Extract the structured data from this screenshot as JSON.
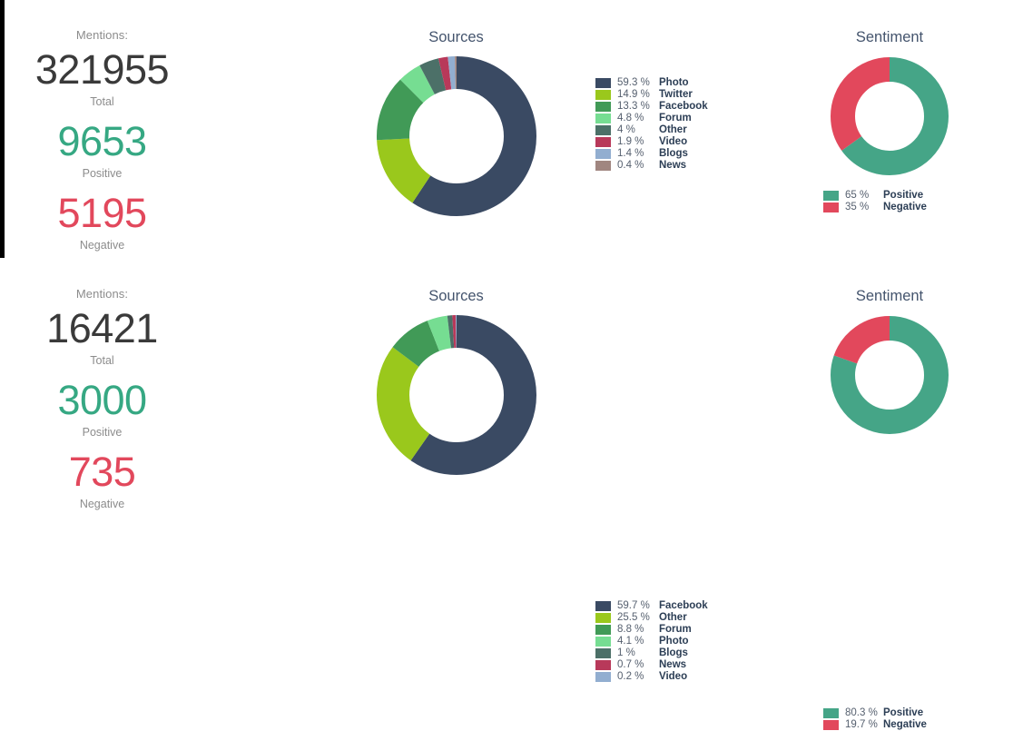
{
  "theme": {
    "navy": "#3a4a63",
    "lime": "#9ac81c",
    "green": "#419a57",
    "mint": "#76dd92",
    "slate_green": "#4c7068",
    "crimson": "#b8395a",
    "periwinkle": "#92aed0",
    "mauve": "#a08680",
    "sentiment_positive": "#45a587",
    "sentiment_negative": "#e2485c",
    "title_color": "#44546d",
    "total_color": "#3a3a3a"
  },
  "rows": [
    {
      "mentions": {
        "caption": "Mentions:",
        "total_value": "321955",
        "total_label": "Total",
        "positive_value": "9653",
        "positive_label": "Positive",
        "negative_value": "5195",
        "negative_label": "Negative"
      },
      "sources": {
        "title": "Sources",
        "chart_data": {
          "type": "pie",
          "title": "Sources",
          "donut": true,
          "start_angle": 0,
          "direction": "clockwise",
          "categories": [
            "Photo",
            "Twitter",
            "Facebook",
            "Forum",
            "Other",
            "Video",
            "Blogs",
            "News"
          ],
          "values": [
            59.3,
            14.9,
            13.3,
            4.8,
            4,
            1.9,
            1.4,
            0.4
          ],
          "unit": "%",
          "colors": [
            "#3a4a63",
            "#9ac81c",
            "#419a57",
            "#76dd92",
            "#4c7068",
            "#b8395a",
            "#92aed0",
            "#a08680"
          ],
          "legend_position": "right"
        },
        "legend": [
          {
            "pct": "59.3 %",
            "label": "Photo",
            "color": "#3a4a63"
          },
          {
            "pct": "14.9 %",
            "label": "Twitter",
            "color": "#9ac81c"
          },
          {
            "pct": "13.3 %",
            "label": "Facebook",
            "color": "#419a57"
          },
          {
            "pct": "4.8 %",
            "label": "Forum",
            "color": "#76dd92"
          },
          {
            "pct": "4 %",
            "label": "Other",
            "color": "#4c7068"
          },
          {
            "pct": "1.9 %",
            "label": "Video",
            "color": "#b8395a"
          },
          {
            "pct": "1.4 %",
            "label": "Blogs",
            "color": "#92aed0"
          },
          {
            "pct": "0.4 %",
            "label": "News",
            "color": "#a08680"
          }
        ]
      },
      "sentiment": {
        "title": "Sentiment",
        "chart_data": {
          "type": "pie",
          "title": "Sentiment",
          "donut": true,
          "start_angle": 0,
          "direction": "clockwise",
          "categories": [
            "Positive",
            "Negative"
          ],
          "values": [
            65,
            35
          ],
          "unit": "%",
          "colors": [
            "#45a587",
            "#e2485c"
          ],
          "legend_position": "bottom"
        },
        "legend": [
          {
            "pct": "65 %",
            "label": "Positive",
            "color": "#45a587"
          },
          {
            "pct": "35 %",
            "label": "Negative",
            "color": "#e2485c"
          }
        ]
      }
    },
    {
      "mentions": {
        "caption": "Mentions:",
        "total_value": "16421",
        "total_label": "Total",
        "positive_value": "3000",
        "positive_label": "Positive",
        "negative_value": "735",
        "negative_label": "Negative"
      },
      "sources": {
        "title": "Sources",
        "chart_data": {
          "type": "pie",
          "title": "Sources",
          "donut": true,
          "start_angle": 0,
          "direction": "clockwise",
          "categories": [
            "Facebook",
            "Other",
            "Forum",
            "Photo",
            "Blogs",
            "News",
            "Video"
          ],
          "values": [
            59.7,
            25.5,
            8.8,
            4.1,
            1,
            0.7,
            0.2
          ],
          "unit": "%",
          "colors": [
            "#3a4a63",
            "#9ac81c",
            "#419a57",
            "#76dd92",
            "#4c7068",
            "#b8395a",
            "#92aed0"
          ],
          "legend_position": "right"
        },
        "legend": [
          {
            "pct": "59.7 %",
            "label": "Facebook",
            "color": "#3a4a63"
          },
          {
            "pct": "25.5 %",
            "label": "Other",
            "color": "#9ac81c"
          },
          {
            "pct": "8.8 %",
            "label": "Forum",
            "color": "#419a57"
          },
          {
            "pct": "4.1 %",
            "label": "Photo",
            "color": "#76dd92"
          },
          {
            "pct": "1 %",
            "label": "Blogs",
            "color": "#4c7068"
          },
          {
            "pct": "0.7 %",
            "label": "News",
            "color": "#b8395a"
          },
          {
            "pct": "0.2 %",
            "label": "Video",
            "color": "#92aed0"
          }
        ]
      },
      "sentiment": {
        "title": "Sentiment",
        "chart_data": {
          "type": "pie",
          "title": "Sentiment",
          "donut": true,
          "start_angle": 0,
          "direction": "clockwise",
          "categories": [
            "Positive",
            "Negative"
          ],
          "values": [
            80.3,
            19.7
          ],
          "unit": "%",
          "colors": [
            "#45a587",
            "#e2485c"
          ],
          "legend_position": "bottom"
        },
        "legend": [
          {
            "pct": "80.3 %",
            "label": "Positive",
            "color": "#45a587"
          },
          {
            "pct": "19.7 %",
            "label": "Negative",
            "color": "#e2485c"
          }
        ]
      }
    }
  ]
}
